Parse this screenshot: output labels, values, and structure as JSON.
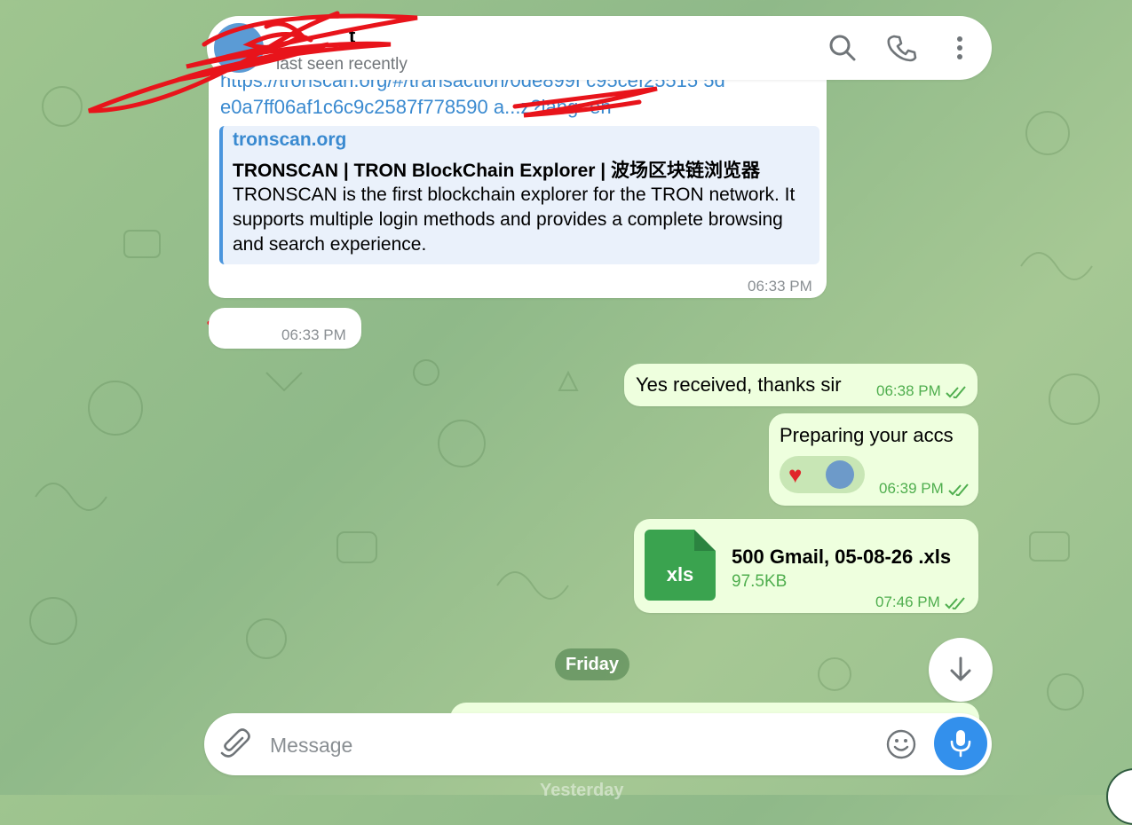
{
  "header": {
    "chat_name": "t",
    "status": "last seen recently"
  },
  "messages": {
    "link_message": {
      "url": "https://tronscan.org/#/transaction/0de899f...c95cef25515 5de0a7ff06af1c6c9c2587f778590...?lang=en",
      "url_line1": "https://tronscan.org/#/transaction/0de899f  c95cef25515 5d",
      "url_line2": "e0a7ff06af1c6c9c2587f778590           a...z?lang=en",
      "preview_site": "tronscan.org",
      "preview_title": "TRONSCAN | TRON BlockChain Explorer | 波场区块链浏览器",
      "preview_desc": "TRONSCAN is the first blockchain explorer for the TRON network. It supports multiple login methods and provides a complete browsing and search experience.",
      "time": "06:33 PM"
    },
    "redacted_message": {
      "time": "06:33 PM"
    },
    "out1": {
      "text": "Yes received,  thanks sir",
      "time": "06:38 PM"
    },
    "out2": {
      "text": "Preparing your accs",
      "time": "06:39 PM",
      "reactions": [
        "heart-emoji",
        "user-avatar"
      ]
    },
    "file_message": {
      "ext": "xls",
      "name": "500 Gmail, 05-08-26 .xls",
      "size": "97.5KB",
      "time": "07:46 PM"
    }
  },
  "date_separator": "Friday",
  "bottom_date": "Yesterday",
  "composer": {
    "placeholder": "Message"
  },
  "colors": {
    "accent": "#3390ec",
    "out_bubble": "#eeffde",
    "link": "#3a8ad0",
    "file_green": "#3aa34f"
  }
}
